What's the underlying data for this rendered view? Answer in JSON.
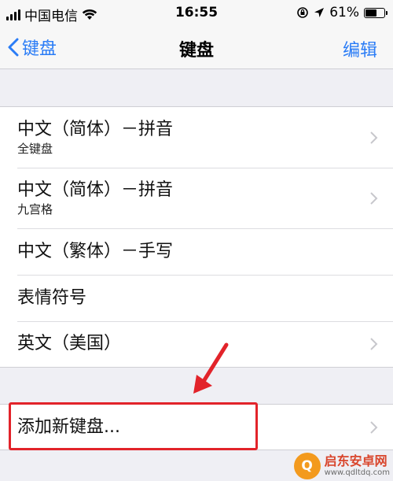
{
  "status_bar": {
    "carrier": "中国电信",
    "time": "16:55",
    "battery": "61%",
    "battery_level": 0.61,
    "icons": [
      "signal-icon",
      "wifi-icon",
      "orientation-lock-icon",
      "location-icon",
      "battery-icon"
    ]
  },
  "nav": {
    "back_label": "键盘",
    "title": "键盘",
    "edit_label": "编辑"
  },
  "keyboards": [
    {
      "title": "中文（简体）－拼音",
      "subtitle": "全键盘",
      "chevron": true
    },
    {
      "title": "中文（简体）－拼音",
      "subtitle": "九宫格",
      "chevron": true
    },
    {
      "title": "中文（繁体）－手写",
      "subtitle": "",
      "chevron": false
    },
    {
      "title": "表情符号",
      "subtitle": "",
      "chevron": false
    },
    {
      "title": "英文（美国）",
      "subtitle": "",
      "chevron": true
    }
  ],
  "add_keyboard": {
    "label": "添加新键盘...",
    "chevron": true
  },
  "annotation": {
    "highlight_color": "#e2232a"
  },
  "watermark": {
    "title": "启东安卓网",
    "url": "www.qdltdq.com",
    "logo_glyph": "Q"
  },
  "colors": {
    "accent": "#2a7cf6",
    "background": "#efeff4"
  }
}
